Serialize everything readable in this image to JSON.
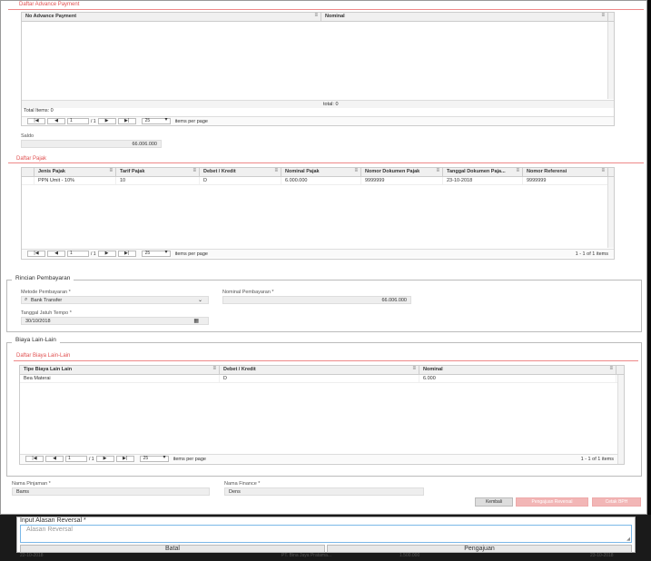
{
  "advance": {
    "section_title": "Daftar Advance Payment",
    "columns": [
      "No Advance Payment",
      "Nominal"
    ],
    "total_label": "total: 0",
    "total_items": "Total Items: 0",
    "pager": {
      "page": "1",
      "of": "/ 1",
      "per_page": "25",
      "per_page_label": "items per page"
    }
  },
  "saldo": {
    "label": "Saldo",
    "value": "66.006.000"
  },
  "pajak": {
    "section_title": "Daftar Pajak",
    "columns": [
      "Jenis Pajak",
      "Tarif Pajak",
      "Debet / Kredit",
      "Nominal Pajak",
      "Nomor Dokumen Pajak",
      "Tanggal Dokumen Paja...",
      "Nomor Referensi"
    ],
    "rows": [
      [
        "PPN Umit - 10%",
        "10",
        "D",
        "6.000.000",
        "9999999",
        "23-10-2018",
        "9999999"
      ]
    ],
    "pager": {
      "page": "1",
      "of": "/ 1",
      "per_page": "25",
      "per_page_label": "items per page",
      "summary": "1 - 1 of 1 items"
    }
  },
  "rincian": {
    "legend": "Rincian Pembayaran",
    "metode_label": "Metode Pembayaran *",
    "metode_value": "Bank Transfer",
    "nominal_label": "Nominal Pembayaran *",
    "nominal_value": "66.006.000",
    "tanggal_label": "Tanggal Jatuh Tempo *",
    "tanggal_value": "30/10/2018"
  },
  "biaya": {
    "legend": "Biaya Lain-Lain",
    "section_title": "Daftar Biaya Lain-Lain",
    "columns": [
      "Tipe Biaya Lain Lain",
      "Debet / Kredit",
      "Nominal"
    ],
    "rows": [
      [
        "Bea Materai",
        "D",
        "6.000"
      ]
    ],
    "pager": {
      "page": "1",
      "of": "/ 1",
      "per_page": "25",
      "per_page_label": "items per page",
      "summary": "1 - 1 of 1 items"
    }
  },
  "pengaju": {
    "pinjaman_label": "Nama Pinjaman *",
    "pinjaman_value": "Bams",
    "finance_label": "Nama Finance *",
    "finance_value": "Dens"
  },
  "actions": {
    "kembali": "Kembali",
    "pengajuan_reversal": "Pengajuan Reversal",
    "cetak": "Cetak BPH"
  },
  "modal": {
    "title": "Input Alasan Reversal *",
    "placeholder": "Alasan Reversal",
    "batal": "Batal",
    "pengajuan": "Pengajuan"
  },
  "background_row": {
    "date": "22-10-2018",
    "ref": "PT. Bina Jaya Pratama...",
    "amount": "1.500.000",
    "date2": "23-10-2018"
  }
}
